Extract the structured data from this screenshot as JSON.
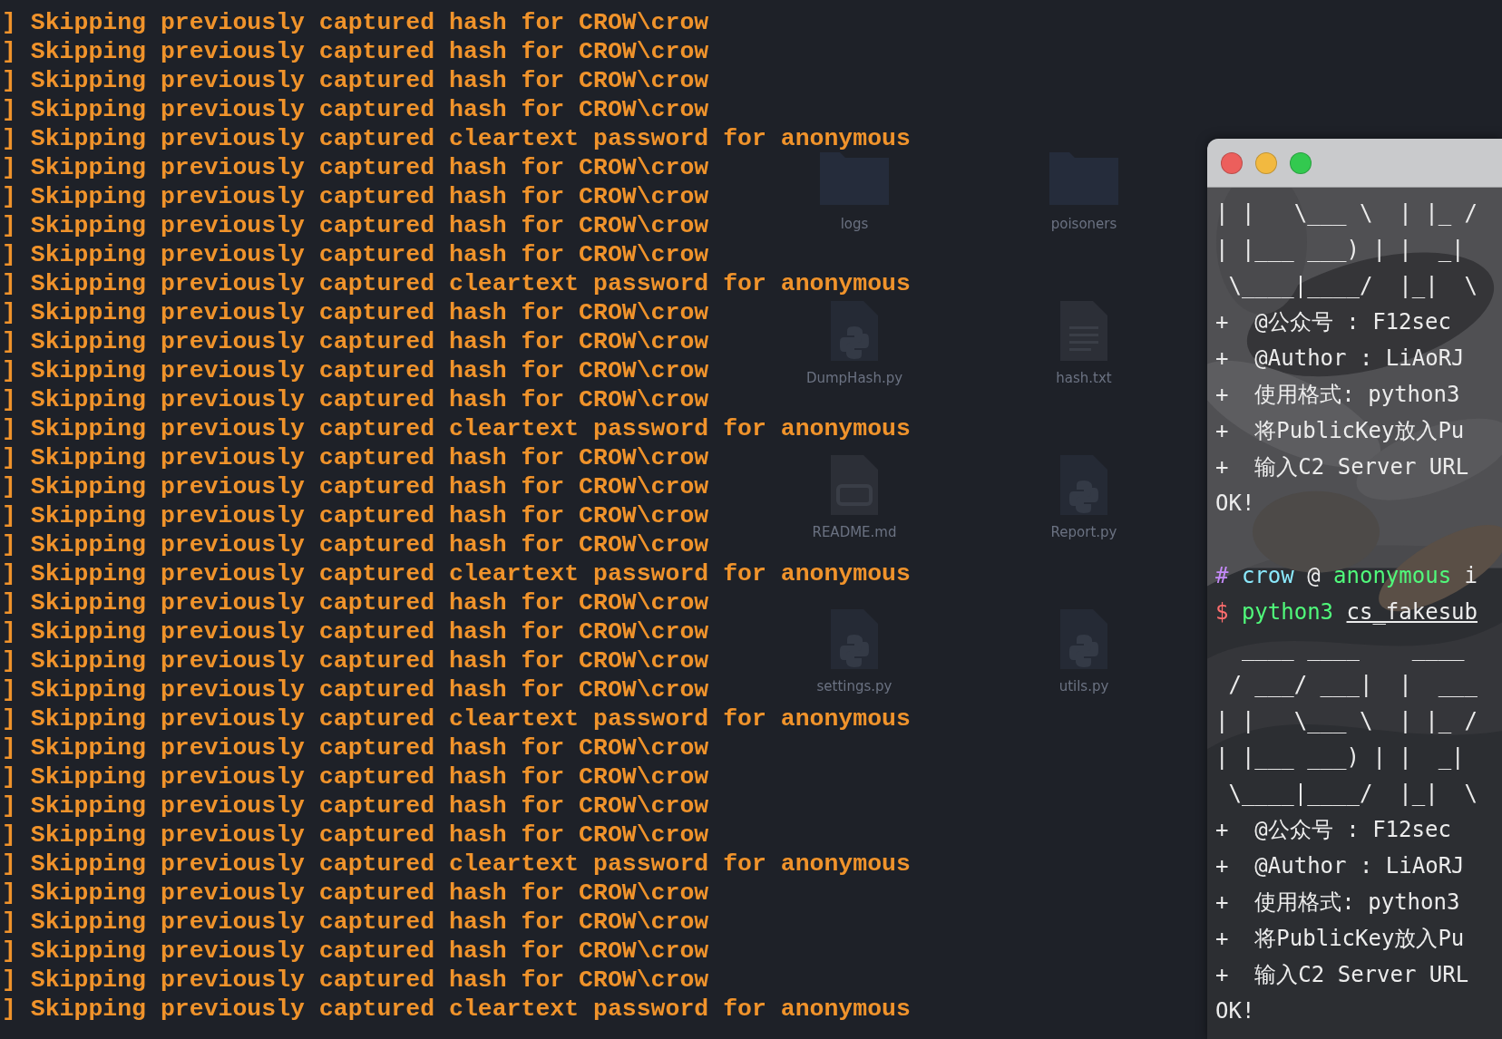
{
  "desktop": {
    "items": [
      {
        "kind": "folder",
        "label": "logs"
      },
      {
        "kind": "folder",
        "label": "poisoners"
      },
      {
        "kind": "python",
        "label": "DumpHash.py"
      },
      {
        "kind": "text",
        "label": "hash.txt"
      },
      {
        "kind": "markdown",
        "label": "README.md"
      },
      {
        "kind": "python",
        "label": "Report.py"
      },
      {
        "kind": "python",
        "label": "settings.py"
      },
      {
        "kind": "python",
        "label": "utils.py"
      }
    ]
  },
  "log_terminal": {
    "lines": [
      "] Skipping previously captured hash for CROW\\crow",
      "] Skipping previously captured hash for CROW\\crow",
      "] Skipping previously captured hash for CROW\\crow",
      "] Skipping previously captured hash for CROW\\crow",
      "] Skipping previously captured cleartext password for anonymous",
      "] Skipping previously captured hash for CROW\\crow",
      "] Skipping previously captured hash for CROW\\crow",
      "] Skipping previously captured hash for CROW\\crow",
      "] Skipping previously captured hash for CROW\\crow",
      "] Skipping previously captured cleartext password for anonymous",
      "] Skipping previously captured hash for CROW\\crow",
      "] Skipping previously captured hash for CROW\\crow",
      "] Skipping previously captured hash for CROW\\crow",
      "] Skipping previously captured hash for CROW\\crow",
      "] Skipping previously captured cleartext password for anonymous",
      "] Skipping previously captured hash for CROW\\crow",
      "] Skipping previously captured hash for CROW\\crow",
      "] Skipping previously captured hash for CROW\\crow",
      "] Skipping previously captured hash for CROW\\crow",
      "] Skipping previously captured cleartext password for anonymous",
      "] Skipping previously captured hash for CROW\\crow",
      "] Skipping previously captured hash for CROW\\crow",
      "] Skipping previously captured hash for CROW\\crow",
      "] Skipping previously captured hash for CROW\\crow",
      "] Skipping previously captured cleartext password for anonymous",
      "] Skipping previously captured hash for CROW\\crow",
      "] Skipping previously captured hash for CROW\\crow",
      "] Skipping previously captured hash for CROW\\crow",
      "] Skipping previously captured hash for CROW\\crow",
      "] Skipping previously captured cleartext password for anonymous",
      "] Skipping previously captured hash for CROW\\crow",
      "] Skipping previously captured hash for CROW\\crow",
      "] Skipping previously captured hash for CROW\\crow",
      "] Skipping previously captured hash for CROW\\crow",
      "] Skipping previously captured cleartext password for anonymous"
    ]
  },
  "terminal_window": {
    "lines": [
      {
        "kind": "art",
        "text": "| |   \\___ \\  | |_ /"
      },
      {
        "kind": "art",
        "text": "| |___ ___) | |  _|"
      },
      {
        "kind": "art",
        "text": " \\____|____/  |_|  \\"
      },
      {
        "kind": "info",
        "text": "+  @公众号 : F12sec"
      },
      {
        "kind": "info",
        "text": "+  @Author : LiAoRJ"
      },
      {
        "kind": "info",
        "text": "+  使用格式: python3"
      },
      {
        "kind": "info",
        "text": "+  将PublicKey放入Pu"
      },
      {
        "kind": "info",
        "text": "+  输入C2 Server URL"
      },
      {
        "kind": "output",
        "text": "OK!"
      },
      {
        "kind": "blank"
      },
      {
        "kind": "prompt",
        "symbol": "#",
        "user": "crow",
        "at": "@",
        "host": "anonymous",
        "rest": "i"
      },
      {
        "kind": "command",
        "symbol": "$",
        "program": "python3",
        "argument": "cs_fakesub"
      },
      {
        "kind": "art",
        "text": "  ____ ____    ____"
      },
      {
        "kind": "art",
        "text": " / ___/ ___|  |  ___"
      },
      {
        "kind": "art",
        "text": "| |   \\___ \\  | |_ /"
      },
      {
        "kind": "art",
        "text": "| |___ ___) | |  _|"
      },
      {
        "kind": "art",
        "text": " \\____|____/  |_|  \\"
      },
      {
        "kind": "info",
        "text": "+  @公众号 : F12sec"
      },
      {
        "kind": "info",
        "text": "+  @Author : LiAoRJ"
      },
      {
        "kind": "info",
        "text": "+  使用格式: python3"
      },
      {
        "kind": "info",
        "text": "+  将PublicKey放入Pu"
      },
      {
        "kind": "info",
        "text": "+  输入C2 Server URL"
      },
      {
        "kind": "output",
        "text": "OK!"
      }
    ]
  }
}
